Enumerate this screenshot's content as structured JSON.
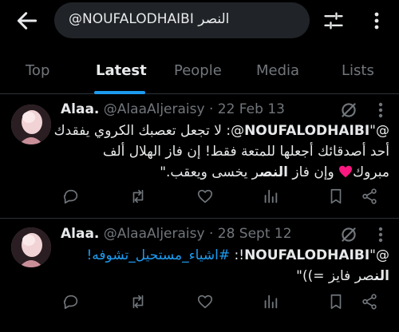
{
  "search": {
    "query": "@NOUFALODHAIBI النصر"
  },
  "tabs": [
    {
      "label": "Top"
    },
    {
      "label": "Latest"
    },
    {
      "label": "People"
    },
    {
      "label": "Media"
    },
    {
      "label": "Lists"
    }
  ],
  "active_tab": "Latest",
  "tweets": [
    {
      "name": "Alaa.",
      "meta": " @AlaaAljeraisy · 22 Feb 13",
      "line1_a": "@\"",
      "line1_b": "NOUFALODHAIBI",
      "line1_c": "@: لا تجعل تعصبك الكروي يفقدك",
      "line2": "أحد أصدقائك أجعلها للمتعة فقط! إن فاز الهلال ألف",
      "line3_a": "مبروك",
      "line3_b": " وإن فاز ",
      "line3_c": "النص",
      "line3_d": "ر يخسى ويعقب.\""
    },
    {
      "name": "Alaa.",
      "meta": " @AlaaAljeraisy · 28 Sept 12",
      "line1_a": "@\"",
      "line1_b": "NOUFALODHAIBI",
      "line1_c": "!: ",
      "line1_tag": "#اشياء_مستحيل_تشوفه!",
      "line2_a": "الن",
      "line2_b": "صر فايز =))\""
    }
  ],
  "icons": {
    "back": "back-arrow-icon",
    "filter": "filter-sliders-icon",
    "more": "more-vertical-icon",
    "grok": "grok-icon",
    "reply": "reply-icon",
    "retweet": "retweet-icon",
    "like": "like-icon",
    "views": "views-icon",
    "bookmark": "bookmark-icon",
    "share": "share-icon"
  },
  "colors": {
    "accent": "#1d9bf0",
    "heart": "#f91880",
    "muted": "#71767b"
  }
}
